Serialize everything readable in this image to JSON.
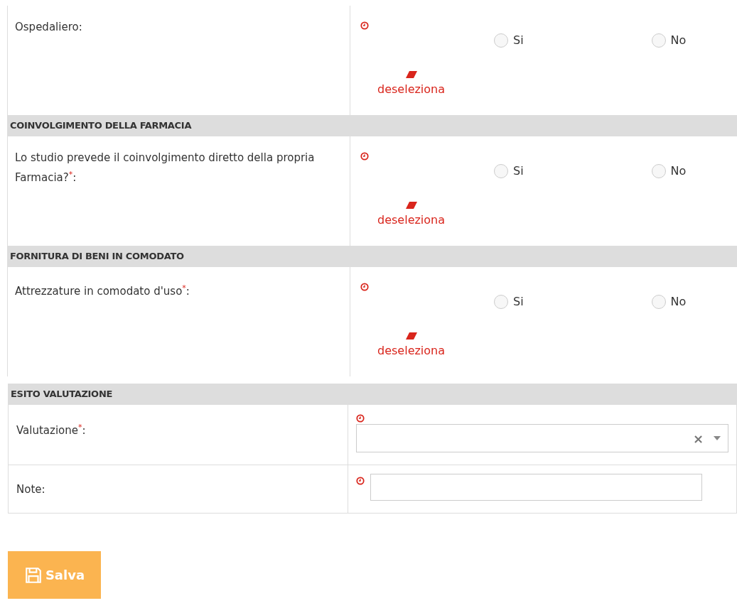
{
  "sections": [
    {
      "fields": [
        {
          "kind": "radio",
          "label": "Ospedaliero:",
          "options": [
            {
              "label": "Si",
              "selected": false
            },
            {
              "label": "No",
              "selected": false
            }
          ],
          "clear_link": "deseleziona"
        }
      ]
    },
    {
      "heading": "COINVOLGIMENTO DELLA FARMACIA",
      "fields": [
        {
          "kind": "radio",
          "label": "Lo studio prevede il coinvolgimento diretto della propria Farmacia?",
          "required_mark": "*",
          "suffix": ":",
          "options": [
            {
              "label": "Si",
              "selected": false
            },
            {
              "label": "No",
              "selected": false
            }
          ],
          "clear_link": "deseleziona"
        }
      ]
    },
    {
      "heading": "FORNITURA DI BENI IN COMODATO",
      "fields": [
        {
          "kind": "radio",
          "label": "Attrezzature in comodato d'uso",
          "required_mark": "*",
          "suffix": ":",
          "options": [
            {
              "label": "Si",
              "selected": false
            },
            {
              "label": "No",
              "selected": false
            }
          ],
          "clear_link": "deseleziona"
        }
      ]
    },
    {
      "heading": "ESITO VALUTAZIONE",
      "fields": [
        {
          "kind": "select",
          "label": "Valutazione",
          "required_mark": "*",
          "suffix": ":",
          "clear_glyph": "×"
        },
        {
          "kind": "text",
          "label": "Note:"
        }
      ]
    }
  ],
  "save_button": "Salva"
}
